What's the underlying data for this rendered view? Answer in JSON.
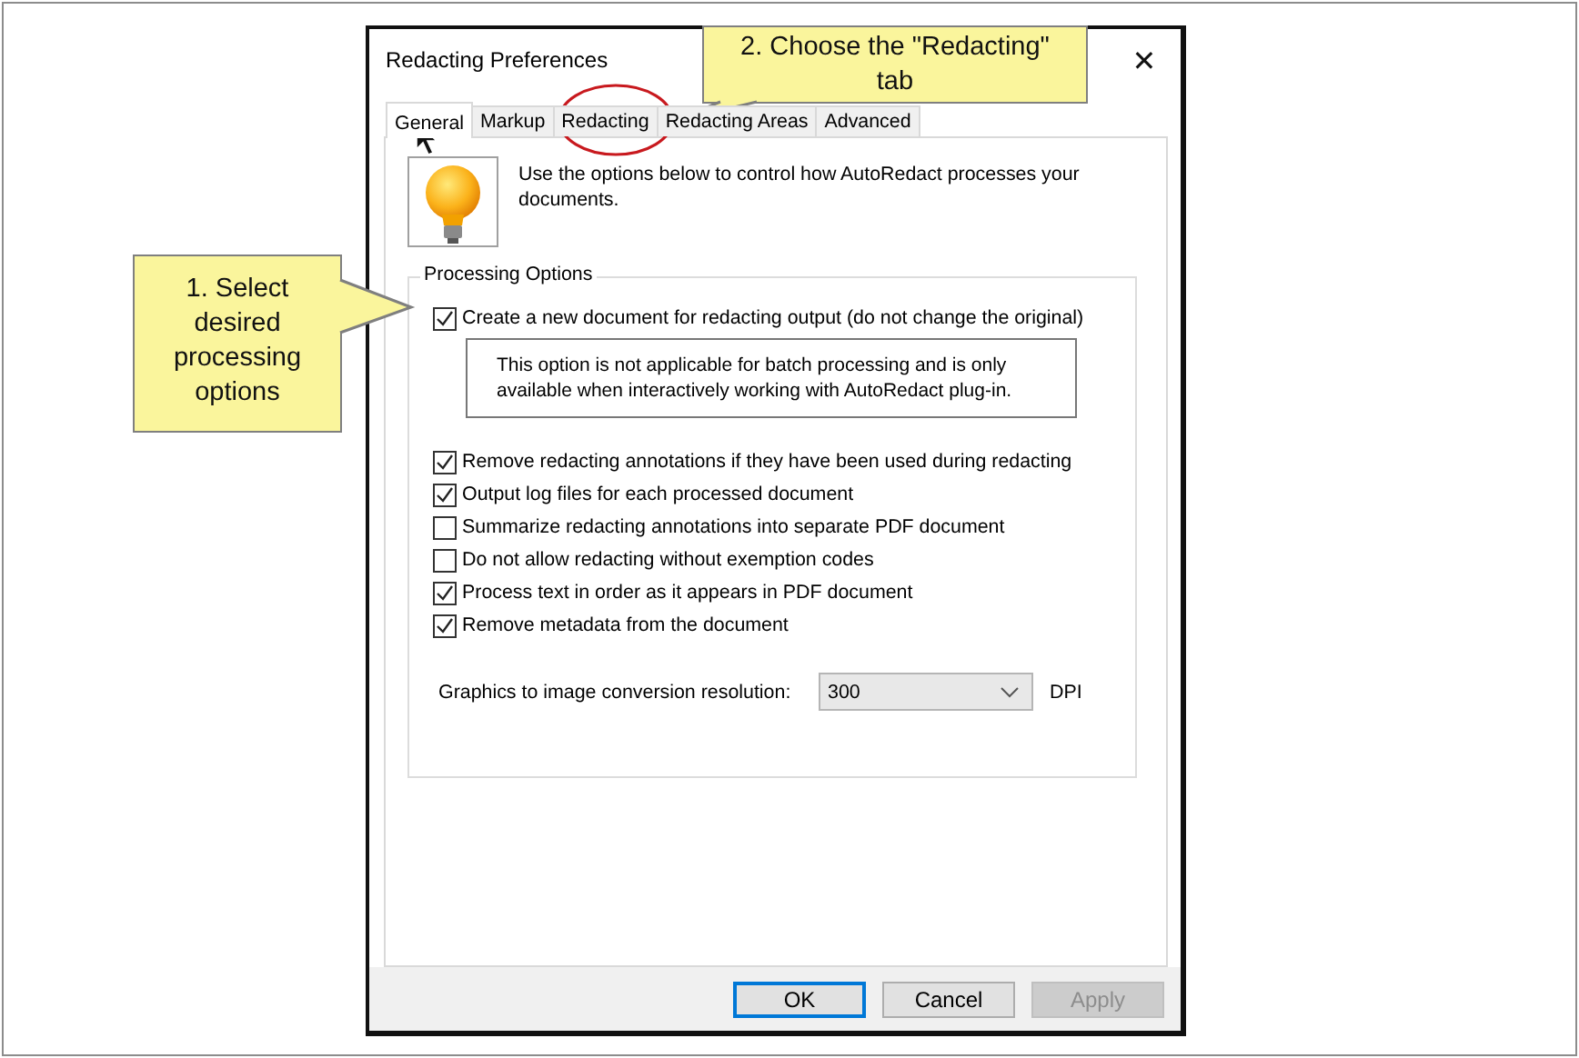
{
  "window": {
    "title": "Redacting Preferences",
    "close": "✕"
  },
  "tabs": [
    {
      "label": "General",
      "selected": true
    },
    {
      "label": "Markup",
      "selected": false
    },
    {
      "label": "Redacting",
      "selected": false
    },
    {
      "label": "Redacting Areas",
      "selected": false
    },
    {
      "label": "Advanced",
      "selected": false
    }
  ],
  "intro": "Use the options below to control how AutoRedact processes your documents.",
  "group": {
    "title": "Processing Options",
    "options": [
      {
        "kind": "checkbox",
        "label": "Create a new document for redacting output (do not change the original)",
        "checked": true
      },
      {
        "kind": "note",
        "text": "This option is not applicable for batch processing and is only available when interactively working with AutoRedact plug-in."
      },
      {
        "kind": "checkbox",
        "label": "Remove redacting annotations if they have been used during redacting",
        "checked": true
      },
      {
        "kind": "checkbox",
        "label": "Output log files for each processed document",
        "checked": true
      },
      {
        "kind": "checkbox",
        "label": "Summarize redacting annotations into separate PDF document",
        "checked": false
      },
      {
        "kind": "checkbox",
        "label": "Do not allow redacting without exemption codes",
        "checked": false
      },
      {
        "kind": "checkbox",
        "label": "Process text in order as it appears in PDF document",
        "checked": true
      },
      {
        "kind": "checkbox",
        "label": "Remove metadata from the document",
        "checked": true
      }
    ],
    "resolution": {
      "label": "Graphics to image conversion resolution:",
      "value": "300",
      "unit": "DPI"
    }
  },
  "buttons": [
    {
      "label": "OK",
      "default": true,
      "disabled": false
    },
    {
      "label": "Cancel",
      "default": false,
      "disabled": false
    },
    {
      "label": "Apply",
      "default": false,
      "disabled": true
    }
  ],
  "callouts": [
    {
      "text": "1. Select desired processing options"
    },
    {
      "text": "2. Choose the \"Redacting\" tab"
    }
  ]
}
